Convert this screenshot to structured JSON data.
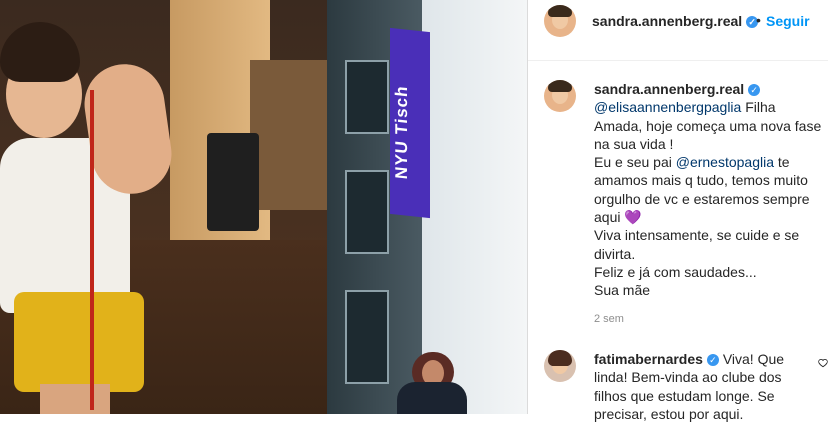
{
  "post": {
    "author": "sandra.annenberg.real",
    "follow_label": "Seguir",
    "dot": "•",
    "verified_mark": "✓",
    "banner_text": "NYU Tisch",
    "caption": {
      "author": "sandra.annenberg.real",
      "mention_daughter": "@elisaannenbergpaglia",
      "line1_rest": " Filha Amada, hoje começa uma nova fase na sua vida !",
      "line2_start": "Eu e seu pai ",
      "mention_father": "@ernestopaglia",
      "line2_rest": " te amamos mais q tudo, temos muito orgulho de vc e estaremos sempre aqui ",
      "heart": "💜",
      "line3": "Viva intensamente, se cuide e se divirta.",
      "line4": "Feliz e já com saudades...",
      "line5": "Sua mãe"
    },
    "time_ago": "2 sem"
  },
  "comments": [
    {
      "author": "fatimabernardes",
      "text": " Viva! Que linda! Bem-vinda ao clube dos filhos que estudam longe. Se precisar, estou por aqui."
    }
  ],
  "icons": {
    "like": "heart-outline-icon"
  }
}
